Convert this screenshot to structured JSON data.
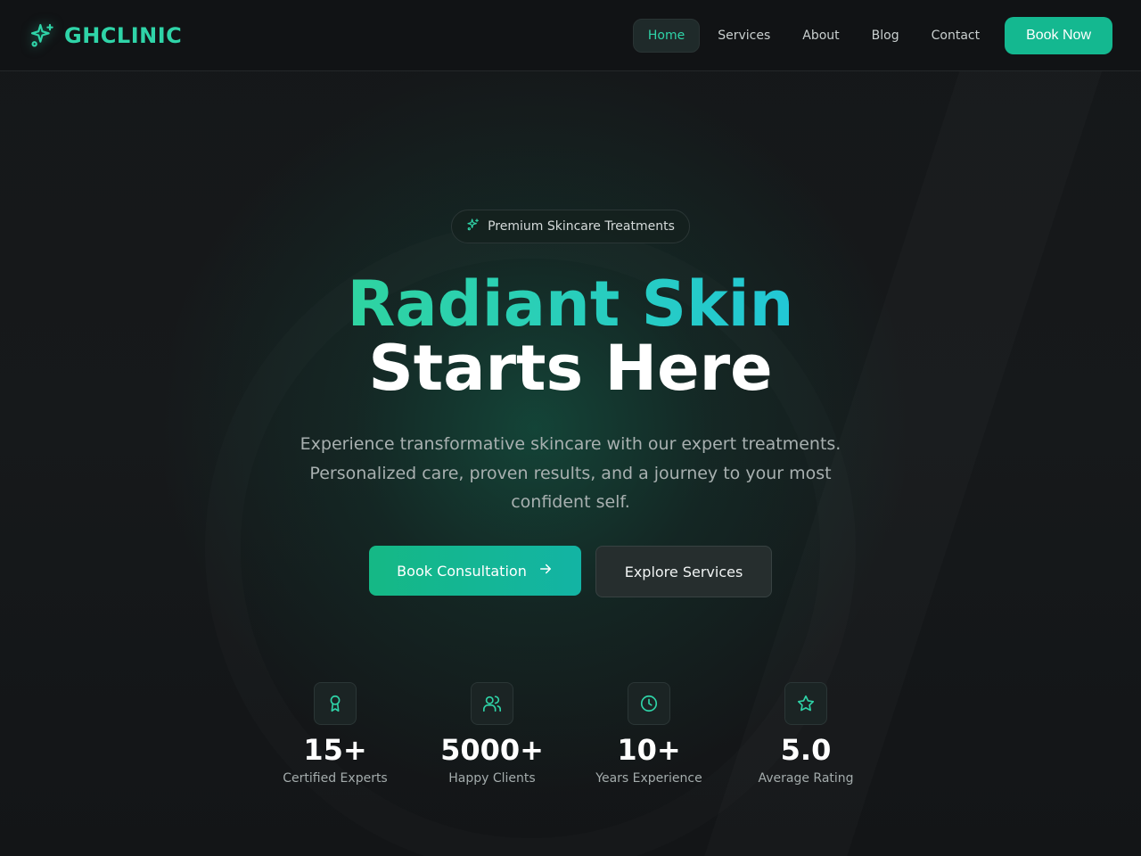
{
  "brand": {
    "name": "GHCLINIC",
    "icon": "sparkles-icon"
  },
  "nav": {
    "items": [
      {
        "label": "Home",
        "active": true
      },
      {
        "label": "Services",
        "active": false
      },
      {
        "label": "About",
        "active": false
      },
      {
        "label": "Blog",
        "active": false
      },
      {
        "label": "Contact",
        "active": false
      }
    ],
    "cta_label": "Book Now"
  },
  "hero": {
    "badge": "Premium Skincare Treatments",
    "title_line1": "Radiant Skin",
    "title_line2": "Starts Here",
    "subtitle": "Experience transformative skincare with our expert treatments. Personalized care, proven results, and a journey to your most confident self.",
    "primary_button": "Book Consultation",
    "secondary_button": "Explore Services"
  },
  "stats": [
    {
      "value": "15+",
      "label": "Certified Experts",
      "icon": "award-icon"
    },
    {
      "value": "5000+",
      "label": "Happy Clients",
      "icon": "users-icon"
    },
    {
      "value": "10+",
      "label": "Years Experience",
      "icon": "clock-icon"
    },
    {
      "value": "5.0",
      "label": "Average Rating",
      "icon": "star-icon"
    }
  ],
  "colors": {
    "accent": "#2fd4a8",
    "button": "#14b890",
    "background": "#121416"
  }
}
